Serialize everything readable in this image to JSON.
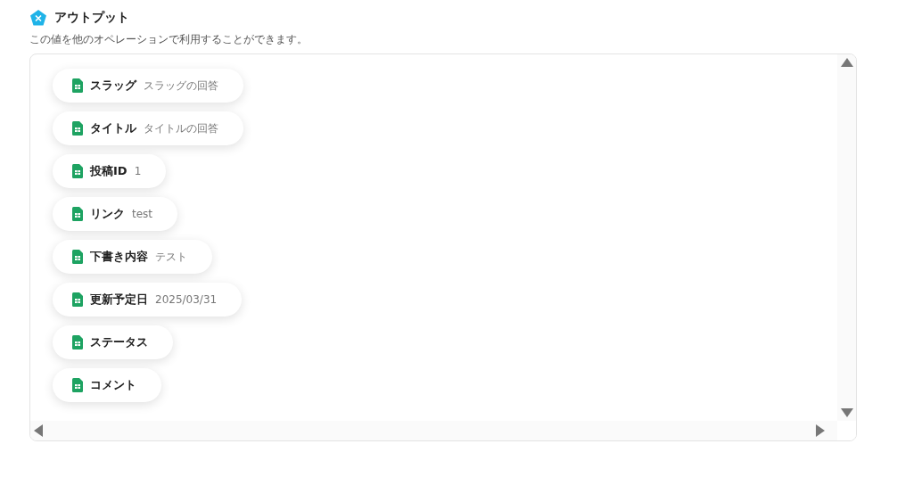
{
  "header": {
    "title": "アウトプット",
    "description": "この値を他のオペレーションで利用することができます。"
  },
  "outputs": [
    {
      "name": "スラッグ",
      "value": "スラッグの回答"
    },
    {
      "name": "タイトル",
      "value": "タイトルの回答"
    },
    {
      "name": "投稿ID",
      "value": "1"
    },
    {
      "name": "リンク",
      "value": "test"
    },
    {
      "name": "下書き内容",
      "value": "テスト"
    },
    {
      "name": "更新予定日",
      "value": "2025/03/31"
    },
    {
      "name": "ステータス"
    },
    {
      "name": "コメント"
    }
  ]
}
